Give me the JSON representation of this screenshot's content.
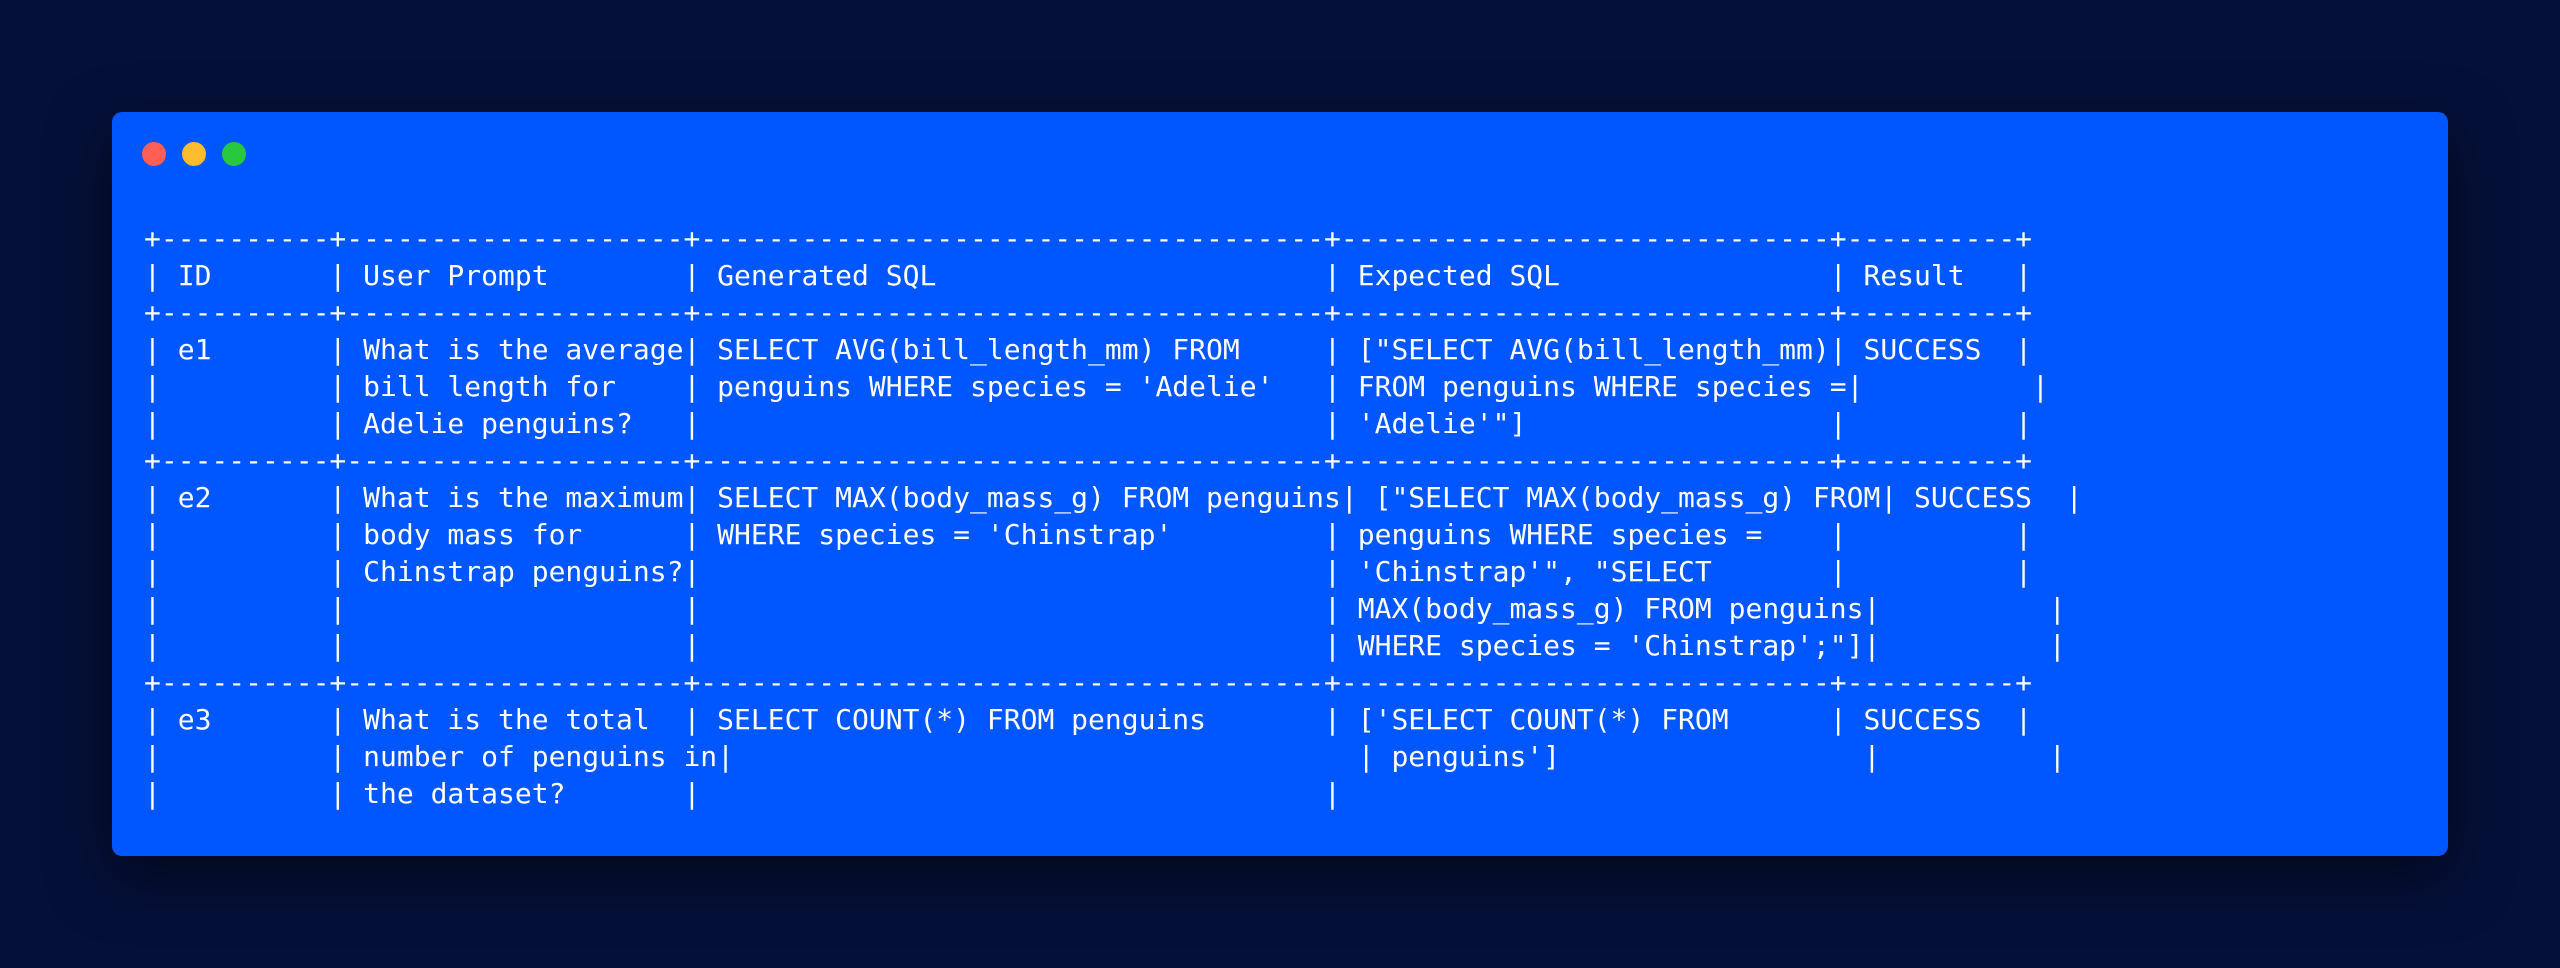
{
  "window": {
    "controls": [
      {
        "name": "close-icon",
        "color": "#ff5f57"
      },
      {
        "name": "minimize-icon",
        "color": "#febc2e"
      },
      {
        "name": "maximize-icon",
        "color": "#28c840"
      }
    ]
  },
  "table": {
    "columns": [
      {
        "header": "ID",
        "width": 10
      },
      {
        "header": "User Prompt",
        "width": 20
      },
      {
        "header": "Generated SQL",
        "width": 37
      },
      {
        "header": "Expected SQL",
        "width": 29
      },
      {
        "header": "Result",
        "width": 10
      }
    ],
    "rows": [
      {
        "id": "e1",
        "cells": [
          [
            "e1"
          ],
          [
            "What is the average",
            "bill length for",
            "Adelie penguins?"
          ],
          [
            "SELECT AVG(bill_length_mm) FROM",
            "penguins WHERE species = 'Adelie'"
          ],
          [
            "[\"SELECT AVG(bill_length_mm)",
            "FROM penguins WHERE species =",
            "'Adelie'\"]"
          ],
          [
            "SUCCESS"
          ]
        ]
      },
      {
        "id": "e2",
        "cells": [
          [
            "e2"
          ],
          [
            "What is the maximum",
            "body mass for",
            "Chinstrap penguins?"
          ],
          [
            "SELECT MAX(body_mass_g) FROM penguins",
            "WHERE species = 'Chinstrap'"
          ],
          [
            "[\"SELECT MAX(body_mass_g) FROM",
            "penguins WHERE species =",
            "'Chinstrap'\", \"SELECT",
            "MAX(body_mass_g) FROM penguins",
            "WHERE species = 'Chinstrap';\"]"
          ],
          [
            "SUCCESS"
          ]
        ]
      },
      {
        "id": "e3",
        "cells": [
          [
            "e3"
          ],
          [
            "What is the total",
            "number of penguins in",
            "the dataset?"
          ],
          [
            "SELECT COUNT(*) FROM penguins"
          ],
          [
            "['SELECT COUNT(*) FROM",
            "penguins']"
          ],
          [
            "SUCCESS"
          ]
        ],
        "partial_frame": true
      }
    ]
  }
}
